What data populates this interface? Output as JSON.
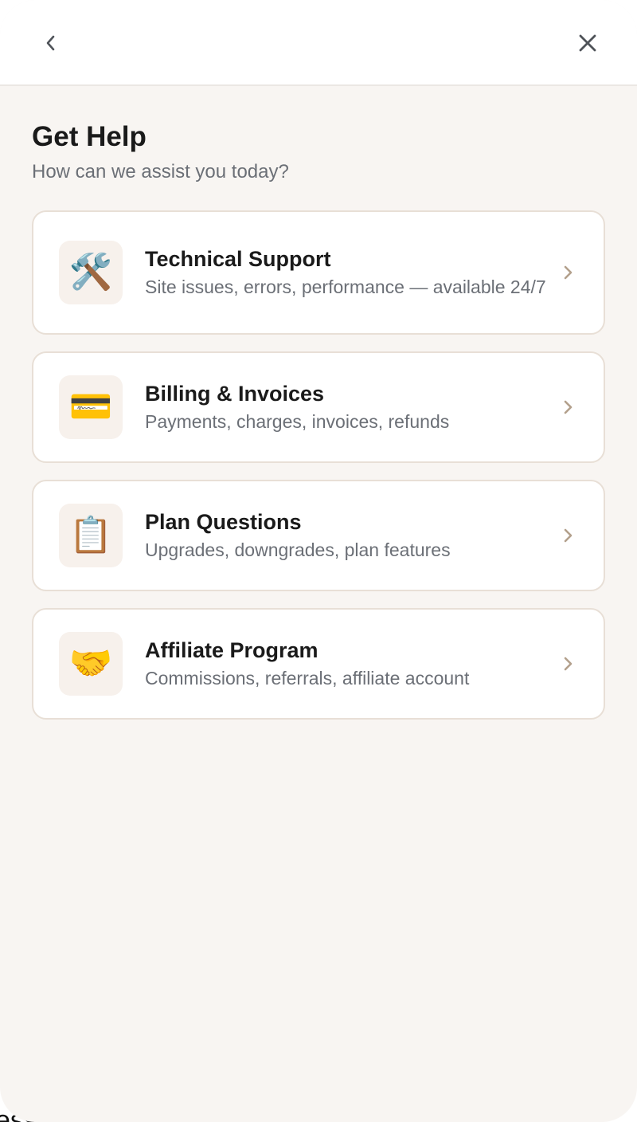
{
  "header": {
    "back_icon": "chevron-left-icon",
    "close_icon": "close-icon"
  },
  "page": {
    "title": "Get Help",
    "subtitle": "How can we assist you today?"
  },
  "options": [
    {
      "icon": "🛠️",
      "icon_name": "tools-icon",
      "title": "Technical Support",
      "description": "Site issues, errors, performance — available 24/7"
    },
    {
      "icon": "💳",
      "icon_name": "credit-card-icon",
      "title": "Billing & Invoices",
      "description": "Payments, charges, invoices, refunds"
    },
    {
      "icon": "📋",
      "icon_name": "clipboard-icon",
      "title": "Plan Questions",
      "description": "Upgrades, downgrades, plan features"
    },
    {
      "icon": "🤝",
      "icon_name": "handshake-icon",
      "title": "Affiliate Program",
      "description": "Commissions, referrals, affiliate account"
    }
  ],
  "background": {
    "partial_text": "ess"
  },
  "colors": {
    "chevron": "#b3a08c",
    "card_border": "#e8dfd6",
    "panel_bg": "#f8f5f2",
    "icon_tile_bg": "#f7f1ec"
  }
}
